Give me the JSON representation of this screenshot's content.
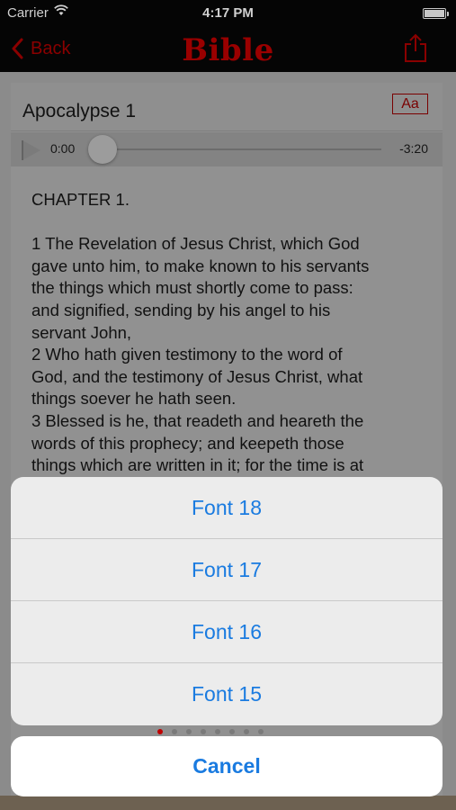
{
  "status_bar": {
    "carrier": "Carrier",
    "time": "4:17 PM",
    "battery_level": 1.0
  },
  "nav": {
    "back_label": "Back",
    "title": "Bible",
    "share_icon": "share-icon"
  },
  "reader": {
    "title": "Apocalypse 1",
    "font_button": "Aa",
    "audio": {
      "elapsed": "0:00",
      "remaining": "-3:20",
      "progress": 0.0
    },
    "chapter_heading": "CHAPTER 1.",
    "lines": [
      "1 The Revelation of Jesus Christ, which God",
      "gave unto him, to make known to his servants",
      "the things which must shortly come to pass:",
      "and signified, sending by his angel to his",
      "servant John,",
      "2 Who hath given testimony to the word of",
      "God, and the testimony of Jesus Christ, what",
      "things soever he hath seen.",
      "3 Blessed is he, that readeth and heareth the",
      "words of this prophecy; and keepeth those",
      "things which are written in it; for the time is at"
    ]
  },
  "action_sheet": {
    "options": [
      "Font 18",
      "Font 17",
      "Font 16",
      "Font 15"
    ],
    "cancel_label": "Cancel"
  },
  "colors": {
    "accent_red": "#9a0000",
    "ios_blue": "#1a7be0"
  }
}
